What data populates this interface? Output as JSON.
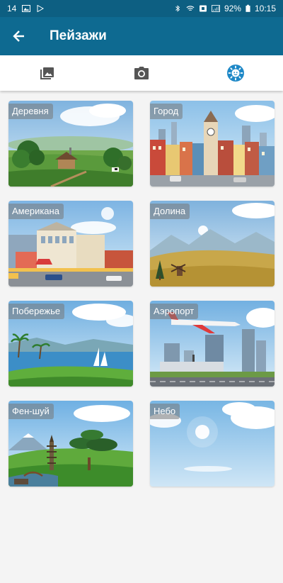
{
  "status_bar": {
    "notif_count": "14",
    "battery": "92%",
    "time": "10:15"
  },
  "app_bar": {
    "title": "Пейзажи",
    "back_icon": "arrow-back-icon"
  },
  "tabs": [
    {
      "icon": "gallery-icon",
      "selected": false
    },
    {
      "icon": "camera-icon",
      "selected": false
    },
    {
      "icon": "sun-icon",
      "selected": true
    }
  ],
  "colors": {
    "status_bar": "#0d5f82",
    "app_bar": "#0e6a91",
    "accent": "#1e88c7"
  },
  "landscapes": [
    {
      "label": "Деревня"
    },
    {
      "label": "Город"
    },
    {
      "label": "Американа"
    },
    {
      "label": "Долина"
    },
    {
      "label": "Побережье"
    },
    {
      "label": "Аэропорт"
    },
    {
      "label": "Фен-шуй"
    },
    {
      "label": "Небо"
    }
  ]
}
